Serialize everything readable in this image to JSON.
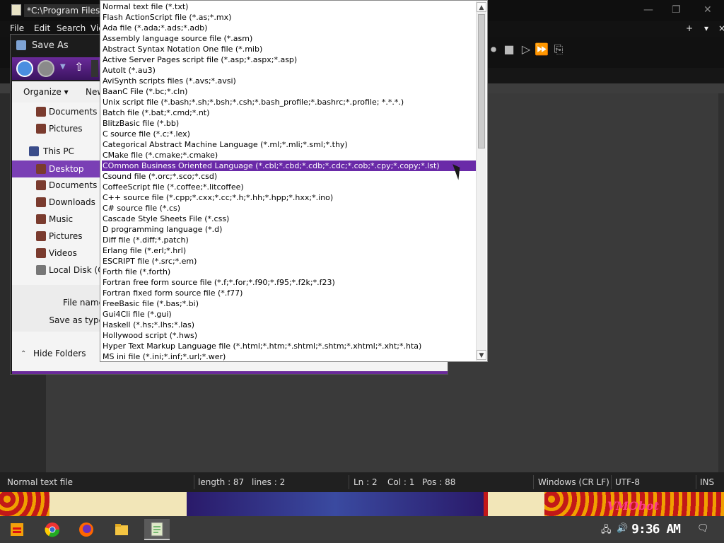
{
  "editor": {
    "title": "*C:\\Program Files\\",
    "menu": [
      "File",
      "Edit",
      "Search",
      "Vie"
    ],
    "window_controls": [
      "+",
      "▾",
      "×"
    ]
  },
  "status": {
    "file_type": "Normal text file",
    "length": "length : 87",
    "lines": "lines : 2",
    "ln": "Ln : 2",
    "col": "Col : 1",
    "pos": "Pos : 88",
    "eol": "Windows (CR LF)",
    "encoding": "UTF-8",
    "mode": "INS"
  },
  "wallpaper": {
    "text": "VMObot"
  },
  "taskbar": {
    "apps": [
      "start-icon",
      "chrome-icon",
      "firefox-icon",
      "file-explorer-icon",
      "notepad-plus-plus-icon"
    ],
    "time": "9:36 AM"
  },
  "dialog": {
    "title": "Save As",
    "organize": "Organize ▾",
    "new_folder": "New",
    "tree": [
      {
        "label": "Documents",
        "indent": 1
      },
      {
        "label": "Pictures",
        "indent": 1
      },
      {
        "label": "This PC",
        "indent": 0
      },
      {
        "label": "Desktop",
        "indent": 1,
        "selected": true
      },
      {
        "label": "Documents",
        "indent": 1
      },
      {
        "label": "Downloads",
        "indent": 1
      },
      {
        "label": "Music",
        "indent": 1
      },
      {
        "label": "Pictures",
        "indent": 1
      },
      {
        "label": "Videos",
        "indent": 1
      },
      {
        "label": "Local Disk (C:",
        "indent": 1
      }
    ],
    "file_name_label": "File name:",
    "save_as_type_label": "Save as type:",
    "hide_folders": "Hide Folders"
  },
  "dropdown": {
    "selected_index": 15,
    "items": [
      "Normal text file (*.txt)",
      "Flash ActionScript file (*.as;*.mx)",
      "Ada file (*.ada;*.ads;*.adb)",
      "Assembly language source file (*.asm)",
      "Abstract Syntax Notation One file (*.mib)",
      "Active Server Pages script file (*.asp;*.aspx;*.asp)",
      "AutoIt (*.au3)",
      "AviSynth scripts files (*.avs;*.avsi)",
      "BaanC File (*.bc;*.cln)",
      "Unix script file (*.bash;*.sh;*.bsh;*.csh;*.bash_profile;*.bashrc;*.profile; *.*.*.)",
      "Batch file (*.bat;*.cmd;*.nt)",
      "BlitzBasic file (*.bb)",
      "C source file (*.c;*.lex)",
      "Categorical Abstract Machine Language (*.ml;*.mli;*.sml;*.thy)",
      "CMake file (*.cmake;*.cmake)",
      "COmmon Business Oriented Language (*.cbl;*.cbd;*.cdb;*.cdc;*.cob;*.cpy;*.copy;*.lst)",
      "Csound file (*.orc;*.sco;*.csd)",
      "CoffeeScript file (*.coffee;*.litcoffee)",
      "C++ source file (*.cpp;*.cxx;*.cc;*.h;*.hh;*.hpp;*.hxx;*.ino)",
      "C# source file (*.cs)",
      "Cascade Style Sheets File (*.css)",
      "D programming language (*.d)",
      "Diff file (*.diff;*.patch)",
      "Erlang file (*.erl;*.hrl)",
      "ESCRIPT file (*.src;*.em)",
      "Forth file (*.forth)",
      "Fortran free form source file (*.f;*.for;*.f90;*.f95;*.f2k;*.f23)",
      "Fortran fixed form source file (*.f77)",
      "FreeBasic file (*.bas;*.bi)",
      "Gui4Cli file (*.gui)",
      "Haskell (*.hs;*.lhs;*.las)",
      "Hollywood script (*.hws)",
      "Hyper Text Markup Language file (*.html;*.htm;*.shtml;*.shtm;*.xhtml;*.xht;*.hta)",
      "MS ini file (*.ini;*.inf;*.url;*.wer)"
    ]
  }
}
